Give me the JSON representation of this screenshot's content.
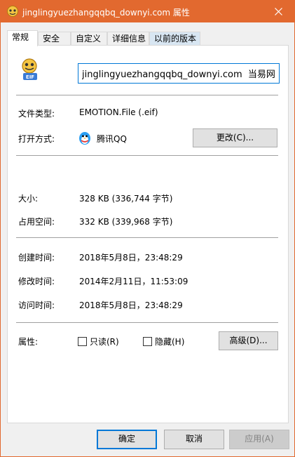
{
  "window": {
    "title": "jinglingyuezhangqqbq_downyi.com 属性",
    "accent": "#e2692f"
  },
  "titlebar": {
    "close_icon": "close-icon"
  },
  "tabs": [
    {
      "label": "常规",
      "active": true
    },
    {
      "label": "安全",
      "active": false
    },
    {
      "label": "自定义",
      "active": false
    },
    {
      "label": "详细信息",
      "active": false
    },
    {
      "label": "以前的版本",
      "active": false
    }
  ],
  "general": {
    "file_icon": "eif-emoticon-icon",
    "filename": "jinglingyuezhangqqbq_downyi.com  当易网",
    "file_type_label": "文件类型:",
    "file_type_value": "EMOTION.File (.eif)",
    "open_with_label": "打开方式:",
    "open_with_icon": "qq-penguin-icon",
    "open_with_value": "腾讯QQ",
    "change_button": "更改(C)...",
    "size_label": "大小:",
    "size_value": "328 KB (336,744 字节)",
    "disk_size_label": "占用空间:",
    "disk_size_value": "332 KB (339,968 字节)",
    "created_label": "创建时间:",
    "created_value": "2018年5月8日，23:48:29",
    "modified_label": "修改时间:",
    "modified_value": "2014年2月11日，11:53:09",
    "accessed_label": "访问时间:",
    "accessed_value": "2018年5月8日，23:48:29",
    "attributes_label": "属性:",
    "readonly_label": "只读(R)",
    "readonly_checked": false,
    "hidden_label": "隐藏(H)",
    "hidden_checked": false,
    "advanced_button": "高级(D)..."
  },
  "footer": {
    "ok_button": "确定",
    "cancel_button": "取消",
    "apply_button": "应用(A)"
  }
}
